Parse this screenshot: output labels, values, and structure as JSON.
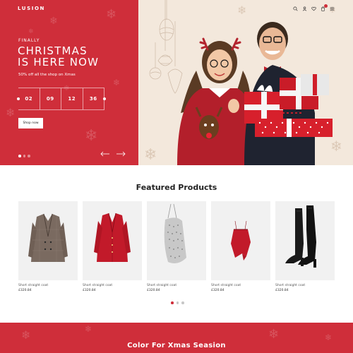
{
  "brand": {
    "logo_text": "LUSION"
  },
  "nav": {
    "icons": [
      "search-icon",
      "user-icon",
      "heart-icon",
      "cart-icon",
      "menu-icon"
    ]
  },
  "hero": {
    "eyebrow": "FINALLY",
    "headline_line1": "CHRISTMAS",
    "headline_line2": "IS HERE NOW",
    "subline": "50% off all the shop on Xmas",
    "countdown": [
      "02",
      "09",
      "12",
      "36"
    ],
    "cta_label": "Shop now",
    "slides_total": 3,
    "active_slide": 1,
    "accent_color": "#cf2e3a",
    "background_right": "#f3e8dc"
  },
  "featured": {
    "title": "Featured Products",
    "products": [
      {
        "name": "Short straight coat",
        "price": "£320.84",
        "image": "plaid-blazer"
      },
      {
        "name": "Short straight coat",
        "price": "£320.84",
        "image": "red-blazer-dress"
      },
      {
        "name": "Short straight coat",
        "price": "£320.84",
        "image": "silver-mesh-bag"
      },
      {
        "name": "Short straight coat",
        "price": "£320.84",
        "image": "red-velvet-camisole"
      },
      {
        "name": "Short straight coat",
        "price": "£320.84",
        "image": "black-knee-boots"
      }
    ],
    "pager_total": 3,
    "pager_active": 1
  },
  "bottom": {
    "title": "Color For Xmas Seasion"
  }
}
